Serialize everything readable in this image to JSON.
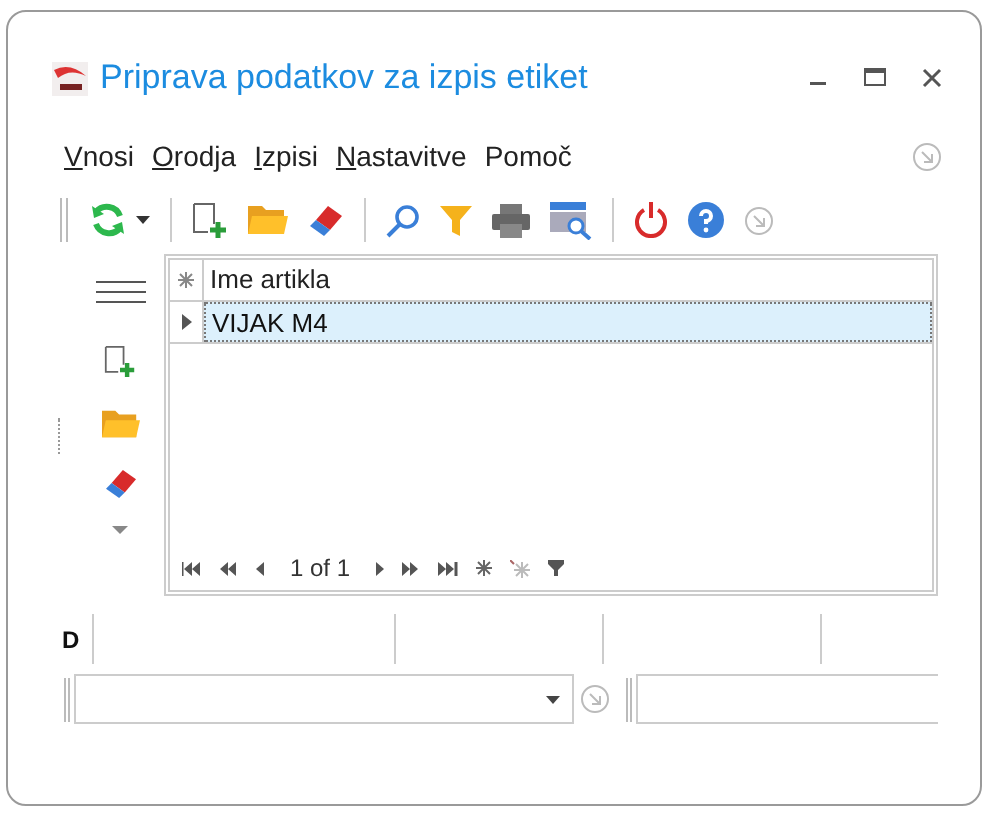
{
  "window": {
    "title": "Priprava podatkov za izpis etiket"
  },
  "menu": [
    {
      "label": "Vnosi",
      "mnemonic": true
    },
    {
      "label": "Orodja",
      "mnemonic": true
    },
    {
      "label": "Izpisi",
      "mnemonic": true
    },
    {
      "label": "Nastavitve",
      "mnemonic": true
    },
    {
      "label": "Pomoč",
      "mnemonic": false
    }
  ],
  "grid": {
    "columns": [
      "Ime artikla"
    ],
    "rows": [
      {
        "cells": [
          "VIJAK M4"
        ],
        "selected": true
      }
    ],
    "navigator": {
      "position": "1 of 1"
    }
  },
  "footer": {
    "label": "D"
  }
}
